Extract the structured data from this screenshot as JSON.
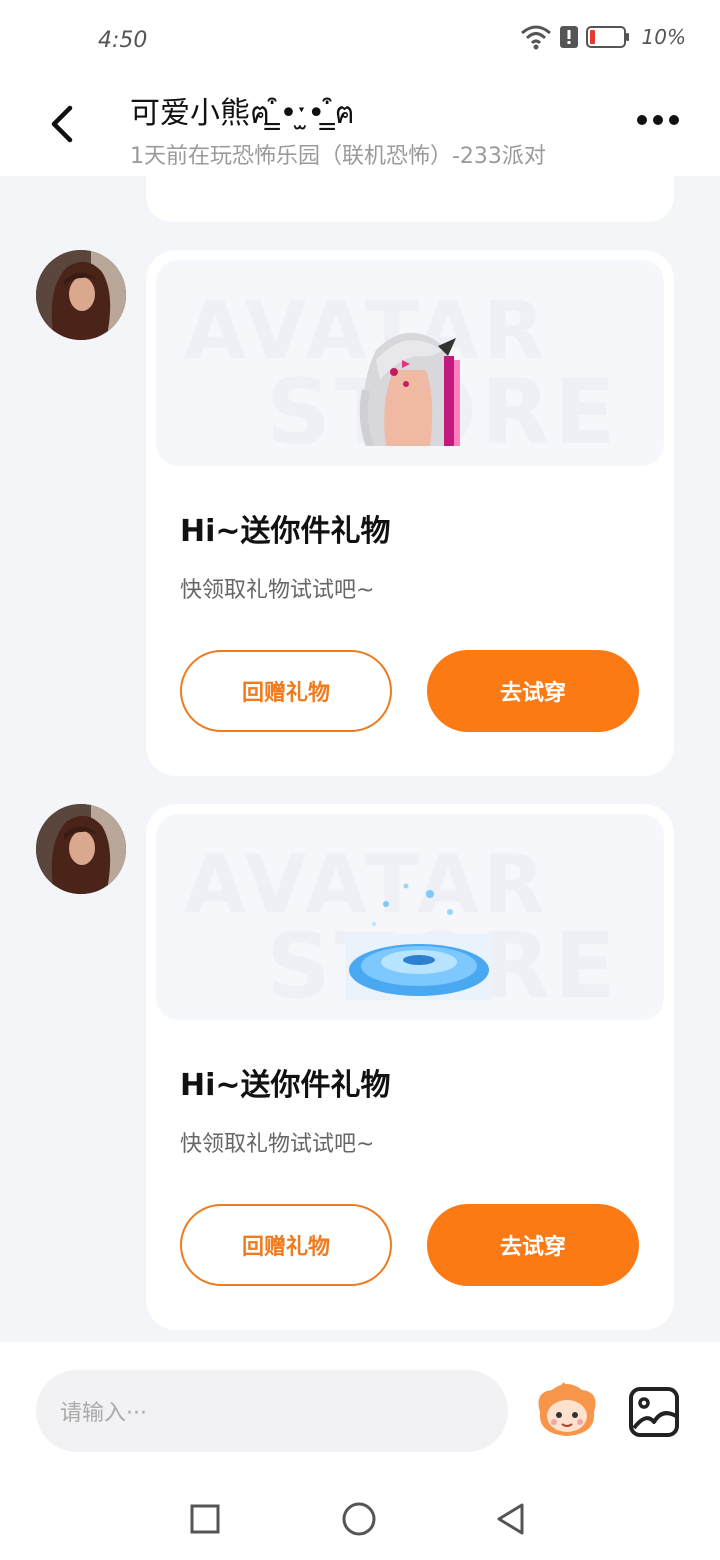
{
  "status_bar": {
    "time": "4:50",
    "battery": "10%",
    "icons": [
      "wifi-icon",
      "alert-icon",
      "battery-icon"
    ]
  },
  "header": {
    "title": "可爱小熊ฅ ̳͒•ˑ̫• ̳͒ฅ",
    "subtitle": "1天前在玩恐怖乐园（联机恐怖）-233派对"
  },
  "messages": [
    {
      "title": "Hi~送你件礼物",
      "desc": "快领取礼物试试吧~",
      "gift_image": "white-haired-avatar-bust",
      "banner_watermark": [
        "AVATAR",
        "STORE"
      ],
      "return_gift_label": "回赠礼物",
      "try_on_label": "去试穿"
    },
    {
      "title": "Hi~送你件礼物",
      "desc": "快领取礼物试试吧~",
      "gift_image": "blue-glowing-platform",
      "banner_watermark": [
        "AVATAR",
        "STORE"
      ],
      "return_gift_label": "回赠礼物",
      "try_on_label": "去试穿"
    }
  ],
  "input": {
    "placeholder": "请输入···"
  },
  "colors": {
    "accent": "#fb7a14",
    "outline": "#f07a1e",
    "background": "#f3f5f9",
    "battery_low": "#e53935"
  }
}
